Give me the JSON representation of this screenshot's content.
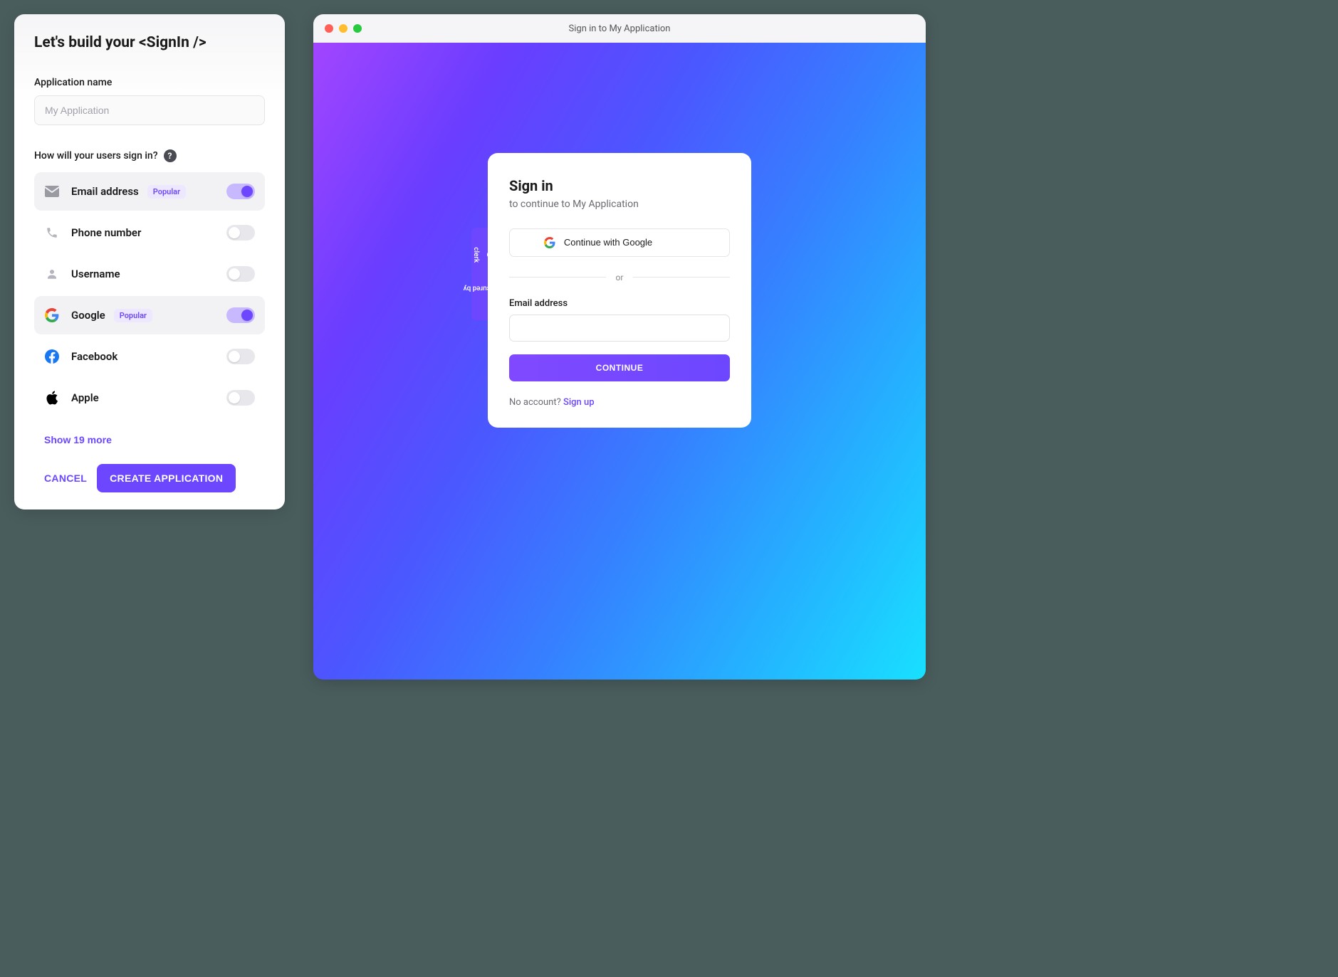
{
  "config": {
    "title_prefix": "Let's build your ",
    "title_component": "<SignIn />",
    "app_name_label": "Application name",
    "app_name_placeholder": "My Application",
    "signin_question": "How will your users sign in?",
    "popular_badge": "Popular",
    "options": {
      "email": {
        "label": "Email address",
        "popular": true,
        "on": true
      },
      "phone": {
        "label": "Phone number",
        "popular": false,
        "on": false
      },
      "username": {
        "label": "Username",
        "popular": false,
        "on": false
      },
      "google": {
        "label": "Google",
        "popular": true,
        "on": true
      },
      "facebook": {
        "label": "Facebook",
        "popular": false,
        "on": false
      },
      "apple": {
        "label": "Apple",
        "popular": false,
        "on": false
      }
    },
    "show_more": "Show 19 more",
    "cancel": "CANCEL",
    "create": "CREATE APPLICATION"
  },
  "preview": {
    "window_title": "Sign in to My Application",
    "secured_by": "Secured by",
    "secured_brand": "clerk",
    "signin_title": "Sign in",
    "signin_subtitle": "to continue to My Application",
    "google_button": "Continue with Google",
    "divider": "or",
    "email_label": "Email address",
    "continue": "CONTINUE",
    "no_account": "No account? ",
    "signup": "Sign up"
  }
}
